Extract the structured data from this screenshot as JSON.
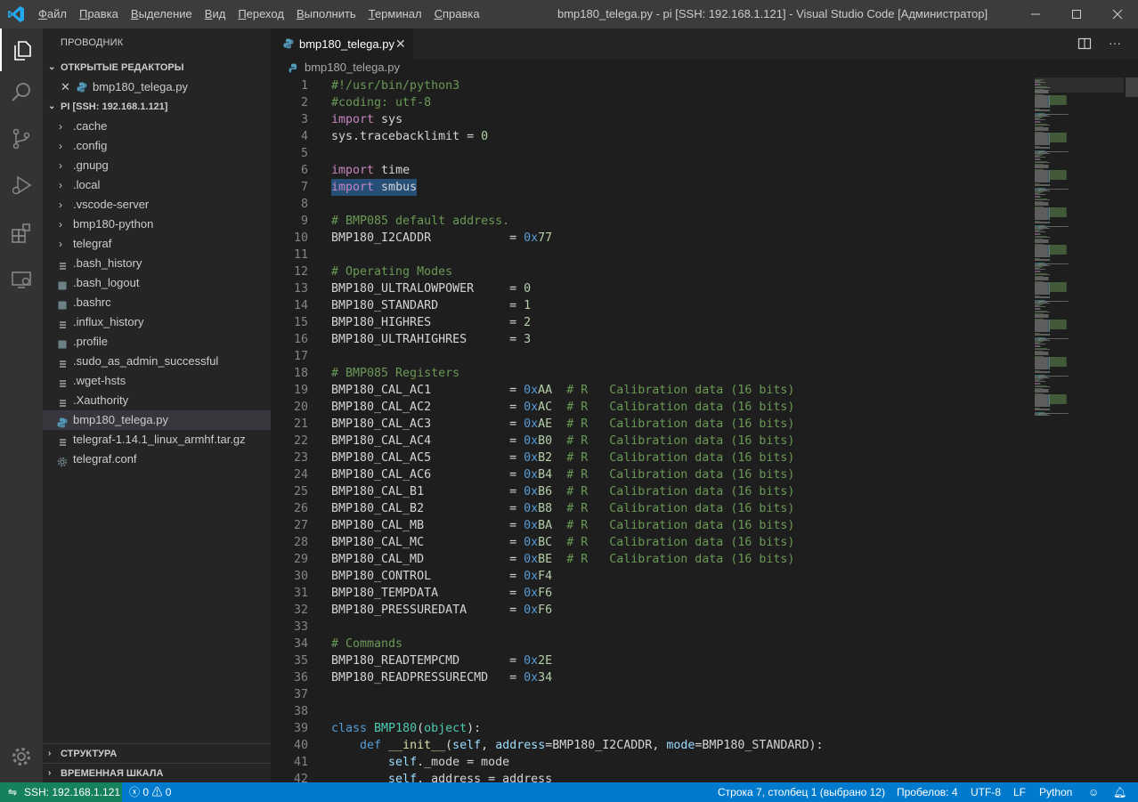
{
  "titlebar": {
    "title": "bmp180_telega.py - pi [SSH: 192.168.1.121] - Visual Studio Code [Администратор]",
    "menu": [
      {
        "u": "Ф",
        "rest": "айл"
      },
      {
        "u": "П",
        "rest": "равка"
      },
      {
        "u": "В",
        "rest": "ыделение"
      },
      {
        "u": "В",
        "rest": "ид"
      },
      {
        "u": "П",
        "rest": "ереход"
      },
      {
        "u": "В",
        "rest": "ыполнить"
      },
      {
        "u": "Т",
        "rest": "ерминал"
      },
      {
        "u": "С",
        "rest": "правка"
      }
    ]
  },
  "sidebar": {
    "title": "ПРОВОДНИК",
    "open_editors_header": "ОТКРЫТЫЕ РЕДАКТОРЫ",
    "open_editor_file": "bmp180_telega.py",
    "workspace_header": "PI [SSH: 192.168.1.121]",
    "items": [
      {
        "label": ".cache",
        "kind": "folder"
      },
      {
        "label": ".config",
        "kind": "folder"
      },
      {
        "label": ".gnupg",
        "kind": "folder"
      },
      {
        "label": ".local",
        "kind": "folder"
      },
      {
        "label": ".vscode-server",
        "kind": "folder"
      },
      {
        "label": "bmp180-python",
        "kind": "folder"
      },
      {
        "label": "telegraf",
        "kind": "folder"
      },
      {
        "label": ".bash_history",
        "kind": "text"
      },
      {
        "label": ".bash_logout",
        "kind": "doc"
      },
      {
        "label": ".bashrc",
        "kind": "doc"
      },
      {
        "label": ".influx_history",
        "kind": "text"
      },
      {
        "label": ".profile",
        "kind": "doc"
      },
      {
        "label": ".sudo_as_admin_successful",
        "kind": "text"
      },
      {
        "label": ".wget-hsts",
        "kind": "text"
      },
      {
        "label": ".Xauthority",
        "kind": "text"
      },
      {
        "label": "bmp180_telega.py",
        "kind": "python"
      },
      {
        "label": "telegraf-1.14.1_linux_armhf.tar.gz",
        "kind": "text"
      },
      {
        "label": "telegraf.conf",
        "kind": "gear"
      }
    ],
    "outline_header": "СТРУКТУРА",
    "timeline_header": "ВРЕМЕННАЯ ШКАЛА"
  },
  "tab": {
    "label": "bmp180_telega.py"
  },
  "breadcrumb": {
    "file": "bmp180_telega.py"
  },
  "editor": {
    "lines": [
      [
        [
          "c",
          "#!/usr/bin/python3"
        ]
      ],
      [
        [
          "c",
          "#coding: utf-8"
        ]
      ],
      [
        [
          "k",
          "import"
        ],
        [
          "p",
          " sys"
        ]
      ],
      [
        [
          "p",
          "sys.tracebacklimit = "
        ],
        [
          "b",
          "0"
        ]
      ],
      [],
      [
        [
          "k",
          "import"
        ],
        [
          "p",
          " time"
        ]
      ],
      [
        [
          "k",
          "import"
        ],
        [
          "p",
          " smbus"
        ]
      ],
      [],
      [
        [
          "c",
          "# BMP085 default address."
        ]
      ],
      [
        [
          "p",
          "BMP180_I2CADDR           = "
        ],
        [
          "n",
          "0x"
        ],
        [
          "b",
          "77"
        ]
      ],
      [],
      [
        [
          "c",
          "# Operating Modes"
        ]
      ],
      [
        [
          "p",
          "BMP180_ULTRALOWPOWER     = "
        ],
        [
          "b",
          "0"
        ]
      ],
      [
        [
          "p",
          "BMP180_STANDARD          = "
        ],
        [
          "b",
          "1"
        ]
      ],
      [
        [
          "p",
          "BMP180_HIGHRES           = "
        ],
        [
          "b",
          "2"
        ]
      ],
      [
        [
          "p",
          "BMP180_ULTRAHIGHRES      = "
        ],
        [
          "b",
          "3"
        ]
      ],
      [],
      [
        [
          "c",
          "# BMP085 Registers"
        ]
      ],
      [
        [
          "p",
          "BMP180_CAL_AC1           = "
        ],
        [
          "n",
          "0x"
        ],
        [
          "b",
          "AA"
        ],
        [
          "c",
          "  # R   Calibration data (16 bits)"
        ]
      ],
      [
        [
          "p",
          "BMP180_CAL_AC2           = "
        ],
        [
          "n",
          "0x"
        ],
        [
          "b",
          "AC"
        ],
        [
          "c",
          "  # R   Calibration data (16 bits)"
        ]
      ],
      [
        [
          "p",
          "BMP180_CAL_AC3           = "
        ],
        [
          "n",
          "0x"
        ],
        [
          "b",
          "AE"
        ],
        [
          "c",
          "  # R   Calibration data (16 bits)"
        ]
      ],
      [
        [
          "p",
          "BMP180_CAL_AC4           = "
        ],
        [
          "n",
          "0x"
        ],
        [
          "b",
          "B0"
        ],
        [
          "c",
          "  # R   Calibration data (16 bits)"
        ]
      ],
      [
        [
          "p",
          "BMP180_CAL_AC5           = "
        ],
        [
          "n",
          "0x"
        ],
        [
          "b",
          "B2"
        ],
        [
          "c",
          "  # R   Calibration data (16 bits)"
        ]
      ],
      [
        [
          "p",
          "BMP180_CAL_AC6           = "
        ],
        [
          "n",
          "0x"
        ],
        [
          "b",
          "B4"
        ],
        [
          "c",
          "  # R   Calibration data (16 bits)"
        ]
      ],
      [
        [
          "p",
          "BMP180_CAL_B1            = "
        ],
        [
          "n",
          "0x"
        ],
        [
          "b",
          "B6"
        ],
        [
          "c",
          "  # R   Calibration data (16 bits)"
        ]
      ],
      [
        [
          "p",
          "BMP180_CAL_B2            = "
        ],
        [
          "n",
          "0x"
        ],
        [
          "b",
          "B8"
        ],
        [
          "c",
          "  # R   Calibration data (16 bits)"
        ]
      ],
      [
        [
          "p",
          "BMP180_CAL_MB            = "
        ],
        [
          "n",
          "0x"
        ],
        [
          "b",
          "BA"
        ],
        [
          "c",
          "  # R   Calibration data (16 bits)"
        ]
      ],
      [
        [
          "p",
          "BMP180_CAL_MC            = "
        ],
        [
          "n",
          "0x"
        ],
        [
          "b",
          "BC"
        ],
        [
          "c",
          "  # R   Calibration data (16 bits)"
        ]
      ],
      [
        [
          "p",
          "BMP180_CAL_MD            = "
        ],
        [
          "n",
          "0x"
        ],
        [
          "b",
          "BE"
        ],
        [
          "c",
          "  # R   Calibration data (16 bits)"
        ]
      ],
      [
        [
          "p",
          "BMP180_CONTROL           = "
        ],
        [
          "n",
          "0x"
        ],
        [
          "b",
          "F4"
        ]
      ],
      [
        [
          "p",
          "BMP180_TEMPDATA          = "
        ],
        [
          "n",
          "0x"
        ],
        [
          "b",
          "F6"
        ]
      ],
      [
        [
          "p",
          "BMP180_PRESSUREDATA      = "
        ],
        [
          "n",
          "0x"
        ],
        [
          "b",
          "F6"
        ]
      ],
      [],
      [
        [
          "c",
          "# Commands"
        ]
      ],
      [
        [
          "p",
          "BMP180_READTEMPCMD       = "
        ],
        [
          "n",
          "0x"
        ],
        [
          "b",
          "2E"
        ]
      ],
      [
        [
          "p",
          "BMP180_READPRESSURECMD   = "
        ],
        [
          "n",
          "0x"
        ],
        [
          "b",
          "34"
        ]
      ],
      [],
      [],
      [
        [
          "h",
          "class"
        ],
        [
          "p",
          " "
        ],
        [
          "t",
          "BMP180"
        ],
        [
          "p",
          "("
        ],
        [
          "t",
          "object"
        ],
        [
          "p",
          "):"
        ]
      ],
      [
        [
          "p",
          "    "
        ],
        [
          "h",
          "def"
        ],
        [
          "p",
          " "
        ],
        [
          "f",
          "__init__"
        ],
        [
          "p",
          "("
        ],
        [
          "v",
          "self"
        ],
        [
          "p",
          ", "
        ],
        [
          "v",
          "address"
        ],
        [
          "p",
          "=BMP180_I2CADDR, "
        ],
        [
          "v",
          "mode"
        ],
        [
          "p",
          "=BMP180_STANDARD):"
        ]
      ],
      [
        [
          "p",
          "        "
        ],
        [
          "v",
          "self"
        ],
        [
          "p",
          "._mode = mode"
        ]
      ],
      [
        [
          "p",
          "        "
        ],
        [
          "v",
          "self"
        ],
        [
          "p",
          "._address = address"
        ]
      ]
    ]
  },
  "statusbar": {
    "remote": "SSH: 192.168.1.121",
    "errors": "0",
    "warnings": "0",
    "cursor": "Строка 7, столбец 1 (выбрано 12)",
    "spaces": "Пробелов: 4",
    "encoding": "UTF-8",
    "eol": "LF",
    "language": "Python"
  },
  "colors": {
    "accent": "#007acc",
    "remote": "#16825d",
    "comment": "#6a9955",
    "keyword": "#c586c0"
  }
}
